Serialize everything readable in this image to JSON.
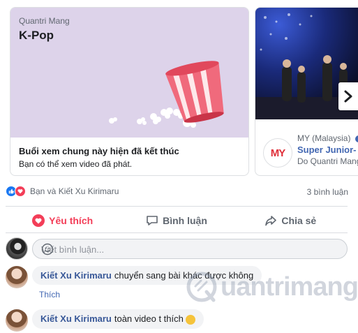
{
  "carousel": {
    "card1": {
      "page_name": "Quantri Mang",
      "title": "K-Pop",
      "footer_title": "Buổi xem chung này hiện đã kết thúc",
      "footer_subtitle": "Bạn có thể xem video đã phát."
    },
    "card2": {
      "logo_text": "MY",
      "page_name": "MY (Malaysia)",
      "title": "Super Junior-",
      "by": "Do Quantri Mang"
    },
    "next_icon": "chevron-right-icon"
  },
  "reactions": {
    "names": "Bạn và Kiết Xu Kirimaru",
    "comment_count": "3 bình luận",
    "like_color": "#1877f2",
    "love_color": "#f33e58"
  },
  "actions": {
    "like_label": "Yêu thích",
    "comment_label": "Bình luận",
    "share_label": "Chia sẻ",
    "active_color": "#f33e58"
  },
  "composer": {
    "placeholder": "Viết bình luận..."
  },
  "comments": [
    {
      "author": "Kiết Xu Kirimaru",
      "text": "chuyển sang bài khác được không",
      "like_label": "Thích"
    },
    {
      "author": "Kiết Xu Kirimaru",
      "text": "toàn video t thích"
    }
  ],
  "watermark": {
    "text": "uantrimang"
  }
}
